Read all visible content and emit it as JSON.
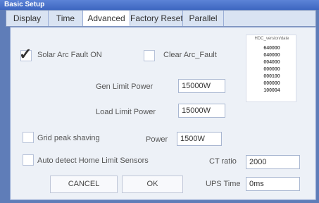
{
  "window": {
    "title": "Basic Setup"
  },
  "tabs": [
    {
      "label": "Display",
      "active": false
    },
    {
      "label": "Time",
      "active": false
    },
    {
      "label": "Advanced",
      "active": true
    },
    {
      "label": "Factory Reset",
      "active": false
    },
    {
      "label": "Parallel",
      "active": false
    }
  ],
  "panel": {
    "solar_arc_fault": {
      "label": "Solar Arc Fault ON",
      "checked": true
    },
    "clear_arc_fault": {
      "label": "Clear Arc_Fault",
      "checked": false
    },
    "gen_limit_power": {
      "label": "Gen Limit Power",
      "value": "15000W"
    },
    "load_limit_power": {
      "label": "Load Limit Power",
      "value": "15000W"
    },
    "grid_peak_shaving": {
      "label": "Grid peak shaving",
      "checked": false
    },
    "power": {
      "label": "Power",
      "value": "1500W"
    },
    "auto_detect": {
      "label": "Auto detect Home Limit Sensors",
      "checked": false
    },
    "ct_ratio": {
      "label": "CT ratio",
      "value": "2000"
    },
    "ups_time": {
      "label": "UPS Time",
      "value": "0ms"
    },
    "cancel_label": "CANCEL",
    "ok_label": "OK",
    "versions": {
      "header": "HDC_version/date",
      "items": [
        "640000",
        "040000",
        "004000",
        "000000",
        "000100",
        "000000",
        "100004"
      ]
    }
  }
}
